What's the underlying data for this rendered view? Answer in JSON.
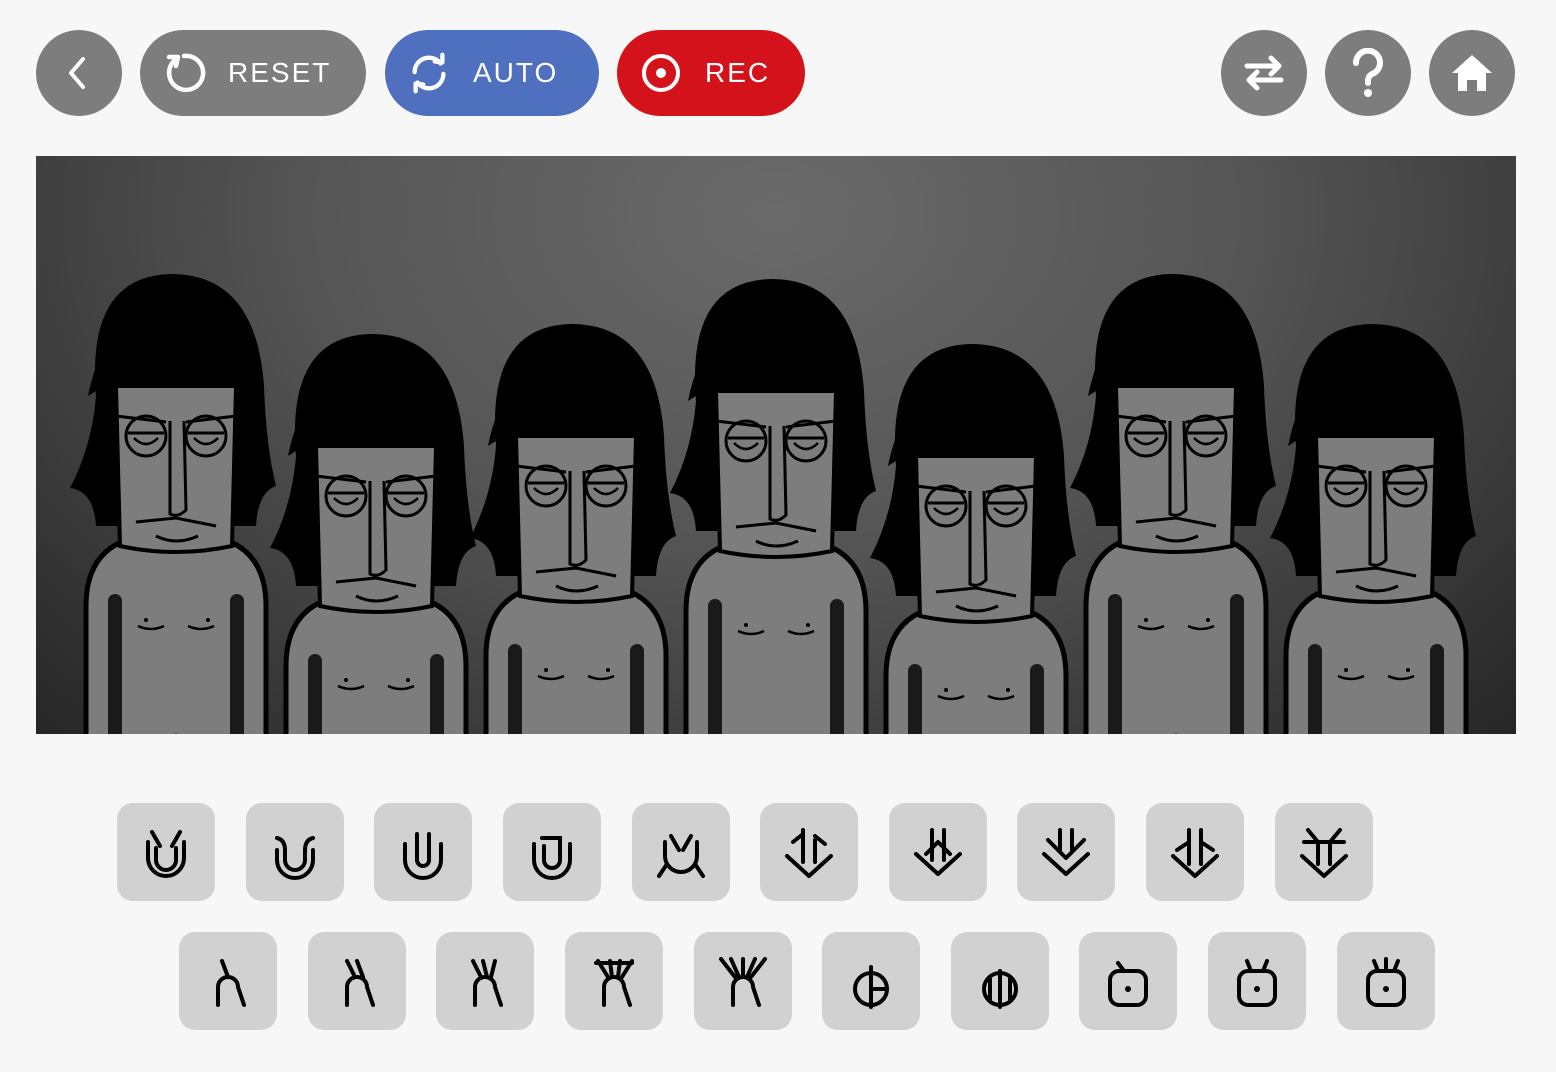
{
  "toolbar": {
    "back": {
      "icon": "chevron-left-icon"
    },
    "reset": {
      "label": "RESET",
      "icon": "refresh-icon",
      "color": "#7d7d7d"
    },
    "auto": {
      "label": "AUTO",
      "icon": "cycle-arrows-icon",
      "color": "#4f6fbf"
    },
    "rec": {
      "label": "REC",
      "icon": "record-icon",
      "color": "#d4121c"
    },
    "swap": {
      "icon": "swap-arrows-icon"
    },
    "help": {
      "icon": "question-icon"
    },
    "home": {
      "icon": "home-icon"
    }
  },
  "stage": {
    "characters": [
      {
        "name": "character-1",
        "state": "idle"
      },
      {
        "name": "character-2",
        "state": "idle"
      },
      {
        "name": "character-3",
        "state": "idle"
      },
      {
        "name": "character-4",
        "state": "idle"
      },
      {
        "name": "character-5",
        "state": "idle"
      },
      {
        "name": "character-6",
        "state": "idle"
      },
      {
        "name": "character-7",
        "state": "idle"
      }
    ]
  },
  "sounds": {
    "row1": [
      {
        "name": "beat-sound-1",
        "icon": "u-horns-icon"
      },
      {
        "name": "beat-sound-2",
        "icon": "u-curl-icon"
      },
      {
        "name": "beat-sound-3",
        "icon": "u-inner-icon"
      },
      {
        "name": "beat-sound-4",
        "icon": "u-hook-icon"
      },
      {
        "name": "beat-sound-5",
        "icon": "u-legs-icon"
      },
      {
        "name": "effect-sound-1",
        "icon": "arrow-split-icon"
      },
      {
        "name": "effect-sound-2",
        "icon": "arrow-diamond-icon"
      },
      {
        "name": "effect-sound-3",
        "icon": "arrow-double-icon"
      },
      {
        "name": "effect-sound-4",
        "icon": "arrow-cross-icon"
      },
      {
        "name": "effect-sound-5",
        "icon": "arrow-fork-icon"
      }
    ],
    "row2": [
      {
        "name": "melody-sound-1",
        "icon": "r-single-icon"
      },
      {
        "name": "melody-sound-2",
        "icon": "r-double-icon"
      },
      {
        "name": "melody-sound-3",
        "icon": "r-triple-icon"
      },
      {
        "name": "melody-sound-4",
        "icon": "r-quad-icon"
      },
      {
        "name": "melody-sound-5",
        "icon": "r-five-icon"
      },
      {
        "name": "voice-sound-1",
        "icon": "split-circle-icon"
      },
      {
        "name": "voice-sound-2",
        "icon": "split-double-icon"
      },
      {
        "name": "voice-sound-3",
        "icon": "square-dot-icon"
      },
      {
        "name": "voice-sound-4",
        "icon": "square-dot-horns-icon"
      },
      {
        "name": "voice-sound-5",
        "icon": "square-dot-triple-icon"
      }
    ]
  }
}
